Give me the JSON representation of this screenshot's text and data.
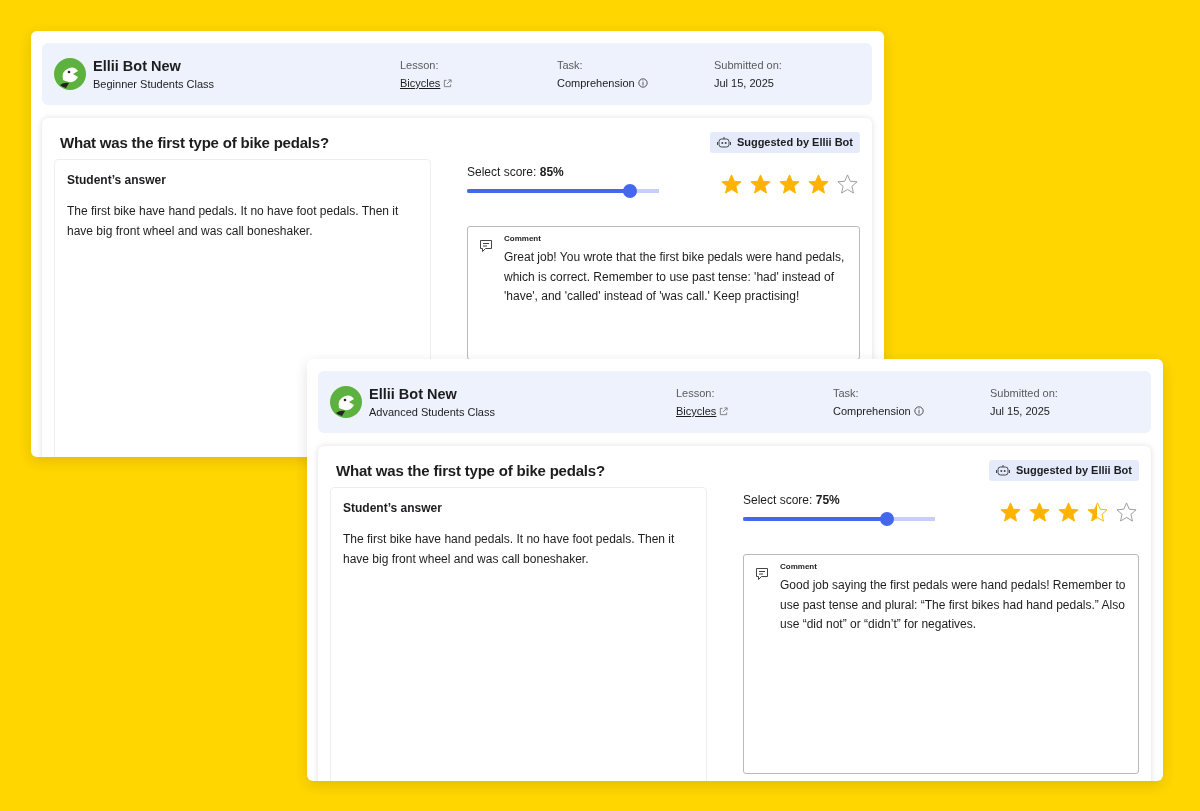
{
  "cards": [
    {
      "header": {
        "name": "Ellii Bot New",
        "class_name": "Beginner Students Class",
        "lesson_label": "Lesson:",
        "lesson": "Bicycles",
        "task_label": "Task:",
        "task": "Comprehension",
        "submitted_label": "Submitted on:",
        "submitted": "Jul 15, 2025"
      },
      "question": "What was the first type of bike pedals?",
      "badge": "Suggested by Ellii Bot",
      "answer_title": "Student’s answer",
      "answer": "The first bike have hand pedals. It no have foot pedals. Then it have big front wheel and was call boneshaker.",
      "score_label": "Select score:",
      "score": "85%",
      "level": 0.85,
      "stars": 4,
      "comment_label": "Comment",
      "comment": "Great job! You wrote that the first bike pedals were hand pedals, which is correct. Remember to use past tense: 'had' instead of 'have', and 'called' instead of 'was call.' Keep practising!"
    },
    {
      "header": {
        "name": "Ellii Bot New",
        "class_name": "Advanced Students Class",
        "lesson_label": "Lesson:",
        "lesson": "Bicycles",
        "task_label": "Task:",
        "task": "Comprehension",
        "submitted_label": "Submitted on:",
        "submitted": "Jul 15, 2025"
      },
      "question": "What was the first type of bike pedals?",
      "badge": "Suggested by Ellii Bot",
      "answer_title": "Student’s answer",
      "answer": "The first bike have hand pedals. It no have foot pedals. Then it have big front wheel and was call boneshaker.",
      "score_label": "Select score:",
      "score": "75%",
      "level": 0.75,
      "stars": 3.5,
      "comment_label": "Comment",
      "comment": "Good job saying the first pedals were hand pedals! Remember to use past tense and plural: “The first bikes had hand pedals.” Also use “did not” or “didn’t” for negatives."
    }
  ]
}
